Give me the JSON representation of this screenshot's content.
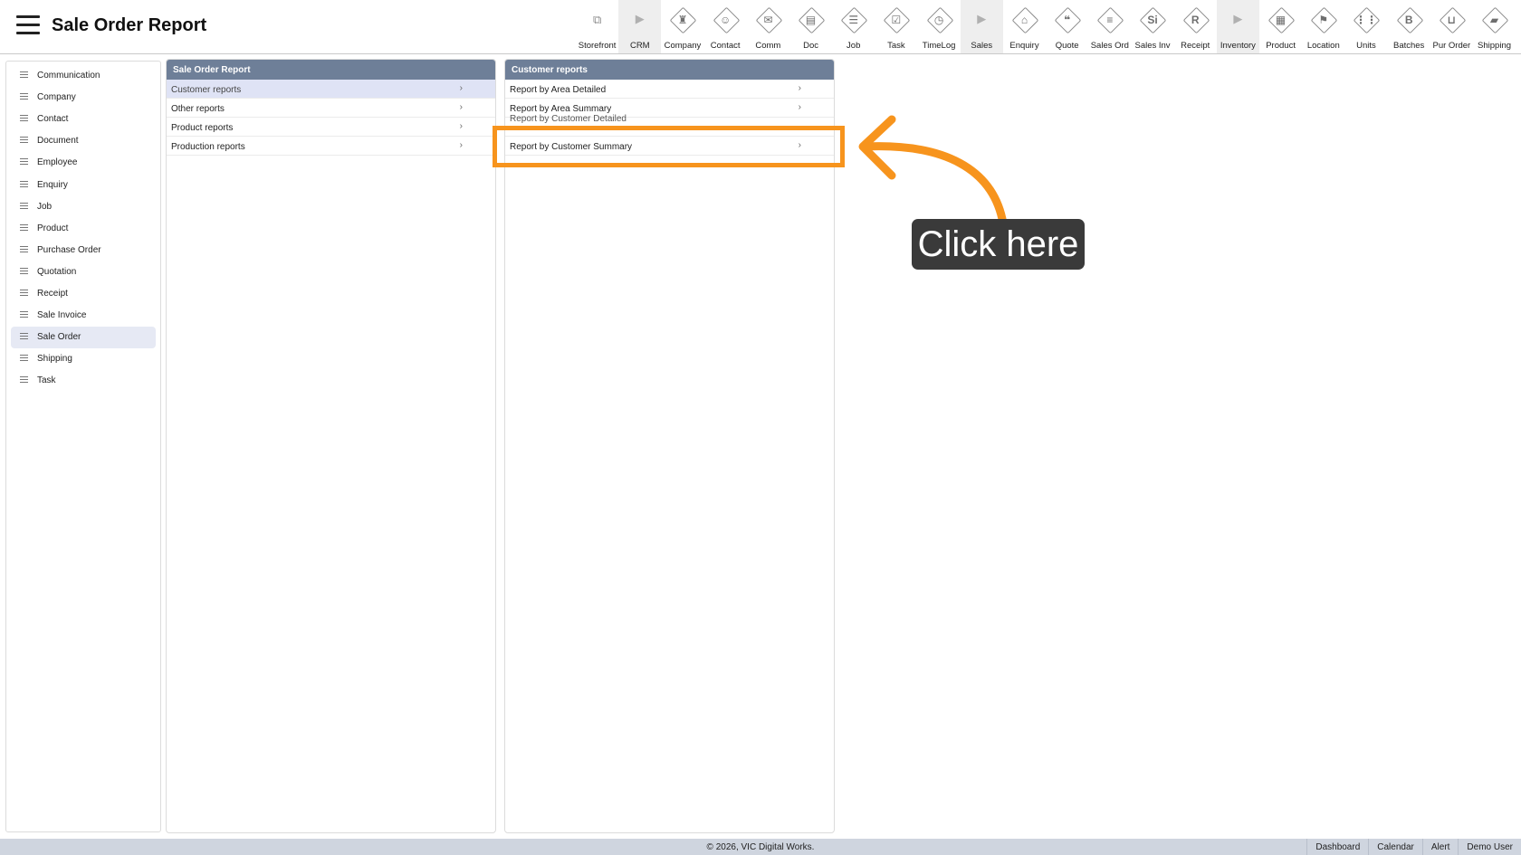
{
  "header": {
    "title": "Sale Order Report",
    "toolbar": [
      {
        "label": "Storefront",
        "icon": "external-link-icon",
        "glyph": "⧉",
        "kind": "plain"
      },
      {
        "label": "CRM",
        "icon": "triangle-right-icon",
        "glyph": "▶",
        "kind": "arrow"
      },
      {
        "label": "Company",
        "icon": "company-icon",
        "glyph": "♜",
        "kind": "dia"
      },
      {
        "label": "Contact",
        "icon": "contact-icon",
        "glyph": "☺",
        "kind": "dia"
      },
      {
        "label": "Comm",
        "icon": "comm-icon",
        "glyph": "✉",
        "kind": "dia"
      },
      {
        "label": "Doc",
        "icon": "doc-icon",
        "glyph": "▤",
        "kind": "dia"
      },
      {
        "label": "Job",
        "icon": "job-icon",
        "glyph": "☰",
        "kind": "dia"
      },
      {
        "label": "Task",
        "icon": "task-icon",
        "glyph": "☑",
        "kind": "dia"
      },
      {
        "label": "TimeLog",
        "icon": "clock-icon",
        "glyph": "◷",
        "kind": "dia"
      },
      {
        "label": "Sales",
        "icon": "triangle-right-icon",
        "glyph": "▶",
        "kind": "arrow"
      },
      {
        "label": "Enquiry",
        "icon": "enquiry-icon",
        "glyph": "⌂",
        "kind": "dia"
      },
      {
        "label": "Quote",
        "icon": "quote-icon",
        "glyph": "❝",
        "kind": "dia"
      },
      {
        "label": "Sales Ord",
        "icon": "sales-order-icon",
        "glyph": "≡",
        "kind": "dia"
      },
      {
        "label": "Sales Inv",
        "icon": "sales-invoice-icon",
        "glyph": "Si",
        "kind": "dia"
      },
      {
        "label": "Receipt",
        "icon": "receipt-icon",
        "glyph": "R",
        "kind": "dia"
      },
      {
        "label": "Inventory",
        "icon": "triangle-right-icon",
        "glyph": "▶",
        "kind": "arrow"
      },
      {
        "label": "Product",
        "icon": "product-icon",
        "glyph": "▦",
        "kind": "dia"
      },
      {
        "label": "Location",
        "icon": "location-icon",
        "glyph": "⚑",
        "kind": "dia"
      },
      {
        "label": "Units",
        "icon": "units-icon",
        "glyph": "⋮⋮",
        "kind": "dia"
      },
      {
        "label": "Batches",
        "icon": "batches-icon",
        "glyph": "B",
        "kind": "dia"
      },
      {
        "label": "Pur Order",
        "icon": "cart-icon",
        "glyph": "⊔",
        "kind": "dia"
      },
      {
        "label": "Shipping",
        "icon": "truck-icon",
        "glyph": "▰",
        "kind": "dia"
      }
    ]
  },
  "sidebar": {
    "items": [
      {
        "label": "Communication"
      },
      {
        "label": "Company"
      },
      {
        "label": "Contact"
      },
      {
        "label": "Document"
      },
      {
        "label": "Employee"
      },
      {
        "label": "Enquiry"
      },
      {
        "label": "Job"
      },
      {
        "label": "Product"
      },
      {
        "label": "Purchase Order"
      },
      {
        "label": "Quotation"
      },
      {
        "label": "Receipt"
      },
      {
        "label": "Sale Invoice"
      },
      {
        "label": "Sale Order",
        "active": true
      },
      {
        "label": "Shipping"
      },
      {
        "label": "Task"
      }
    ]
  },
  "report_panel": {
    "title": "Sale Order Report",
    "items": [
      {
        "label": "Customer reports",
        "selected": true
      },
      {
        "label": "Other reports"
      },
      {
        "label": "Product reports"
      },
      {
        "label": "Production reports"
      }
    ]
  },
  "customer_panel": {
    "title": "Customer reports",
    "items": [
      {
        "label": "Report by Area Detailed"
      },
      {
        "label": "Report by Area Summary"
      },
      {
        "label": "Report by Customer Detailed",
        "partially_hidden": true
      },
      {
        "label": "Report by Customer Summary"
      }
    ]
  },
  "chevron": "›",
  "annotation": {
    "callout_text": "Click here",
    "color": "#f7941d"
  },
  "footer": {
    "copyright": "© 2026, VIC Digital Works.",
    "links": [
      "Dashboard",
      "Calendar",
      "Alert",
      "Demo User"
    ]
  }
}
